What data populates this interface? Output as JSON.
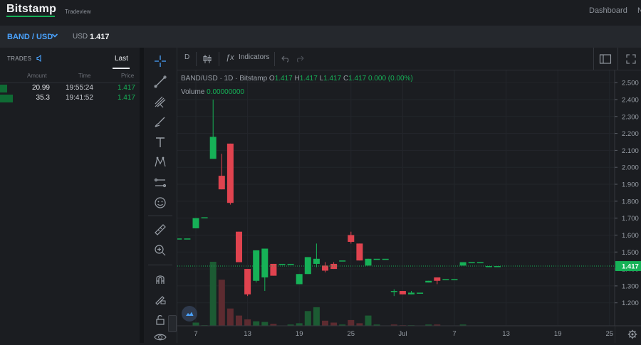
{
  "header": {
    "logo": "Bitstamp",
    "logo_sub": "Tradeview",
    "nav": [
      "Dashboard",
      "N"
    ]
  },
  "pair_bar": {
    "pair": "BAND / USD",
    "currency": "USD",
    "price": "1.417"
  },
  "trades": {
    "title": "TRADES",
    "tab": "Last",
    "columns": [
      "Amount",
      "Time",
      "Price"
    ],
    "rows": [
      {
        "amount": "20.99",
        "time": "19:55:24",
        "price": "1.417",
        "fill": 0.05
      },
      {
        "amount": "35.3",
        "time": "19:41:52",
        "price": "1.417",
        "fill": 0.09
      }
    ]
  },
  "chart_toolbar": {
    "interval": "D",
    "indicators": "Indicators"
  },
  "legend": {
    "symbol": "BAND/USD · 1D · Bitstamp",
    "o_label": "O",
    "o": "1.417",
    "h_label": "H",
    "h": "1.417",
    "l_label": "L",
    "l": "1.417",
    "c_label": "C",
    "c": "1.417",
    "change": "0.000 (0.00%)",
    "volume_label": "Volume",
    "volume": "0.00000000"
  },
  "colors": {
    "up": "#16b157",
    "down": "#e0434f",
    "up_volume": "#1c5b33",
    "down_volume": "#5d2b30",
    "accent": "#4aa3ff",
    "background": "#1b1d21"
  },
  "chart_data": {
    "type": "candlestick",
    "title": "",
    "ylim": [
      1.14,
      2.53
    ],
    "y_ticks": [
      "2.500",
      "2.400",
      "2.300",
      "2.200",
      "2.100",
      "2.000",
      "1.900",
      "1.800",
      "1.700",
      "1.600",
      "1.500",
      "1.400",
      "1.300",
      "1.200"
    ],
    "x_ticks": [
      {
        "label": "7",
        "day": 7
      },
      {
        "label": "13",
        "day": 13
      },
      {
        "label": "19",
        "day": 19
      },
      {
        "label": "25",
        "day": 25
      },
      {
        "label": "Jul",
        "day": 31
      },
      {
        "label": "7",
        "day": 37
      },
      {
        "label": "13",
        "day": 43
      },
      {
        "label": "19",
        "day": 49
      },
      {
        "label": "25",
        "day": 55
      }
    ],
    "last_price": "1.417",
    "last_value": 1.417,
    "candles": [
      {
        "day": 5,
        "o": 1.58,
        "h": 1.58,
        "l": 1.58,
        "c": 1.58
      },
      {
        "day": 6,
        "o": 1.58,
        "h": 1.58,
        "l": 1.58,
        "c": 1.58
      },
      {
        "day": 7,
        "o": 1.64,
        "h": 1.7,
        "l": 1.64,
        "c": 1.7
      },
      {
        "day": 8,
        "o": 1.705,
        "h": 1.705,
        "l": 1.705,
        "c": 1.705
      },
      {
        "day": 9,
        "o": 2.05,
        "h": 2.4,
        "l": 2.05,
        "c": 2.18
      },
      {
        "day": 10,
        "o": 1.95,
        "h": 2.08,
        "l": 1.87,
        "c": 1.87
      },
      {
        "day": 11,
        "o": 2.14,
        "h": 2.14,
        "l": 1.78,
        "c": 1.79
      },
      {
        "day": 12,
        "o": 1.62,
        "h": 1.62,
        "l": 1.44,
        "c": 1.44
      },
      {
        "day": 13,
        "o": 1.4,
        "h": 1.4,
        "l": 1.24,
        "c": 1.25
      },
      {
        "day": 14,
        "o": 1.33,
        "h": 1.51,
        "l": 1.32,
        "c": 1.51
      },
      {
        "day": 15,
        "o": 1.35,
        "h": 1.52,
        "l": 1.27,
        "c": 1.52
      },
      {
        "day": 16,
        "o": 1.43,
        "h": 1.43,
        "l": 1.36,
        "c": 1.36
      },
      {
        "day": 17,
        "o": 1.43,
        "h": 1.43,
        "l": 1.43,
        "c": 1.43
      },
      {
        "day": 18,
        "o": 1.43,
        "h": 1.43,
        "l": 1.43,
        "c": 1.43
      },
      {
        "day": 19,
        "o": 1.31,
        "h": 1.37,
        "l": 1.31,
        "c": 1.37
      },
      {
        "day": 20,
        "o": 1.37,
        "h": 1.47,
        "l": 1.37,
        "c": 1.47
      },
      {
        "day": 21,
        "o": 1.43,
        "h": 1.55,
        "l": 1.41,
        "c": 1.46
      },
      {
        "day": 22,
        "o": 1.42,
        "h": 1.44,
        "l": 1.38,
        "c": 1.39
      },
      {
        "day": 23,
        "o": 1.43,
        "h": 1.44,
        "l": 1.4,
        "c": 1.4
      },
      {
        "day": 24,
        "o": 1.45,
        "h": 1.45,
        "l": 1.45,
        "c": 1.45
      },
      {
        "day": 25,
        "o": 1.6,
        "h": 1.62,
        "l": 1.55,
        "c": 1.56
      },
      {
        "day": 26,
        "o": 1.55,
        "h": 1.55,
        "l": 1.45,
        "c": 1.45
      },
      {
        "day": 27,
        "o": 1.42,
        "h": 1.46,
        "l": 1.42,
        "c": 1.46
      },
      {
        "day": 28,
        "o": 1.46,
        "h": 1.46,
        "l": 1.46,
        "c": 1.46
      },
      {
        "day": 29,
        "o": 1.46,
        "h": 1.46,
        "l": 1.46,
        "c": 1.46
      },
      {
        "day": 30,
        "o": 1.27,
        "h": 1.28,
        "l": 1.24,
        "c": 1.27
      },
      {
        "day": 31,
        "o": 1.27,
        "h": 1.27,
        "l": 1.25,
        "c": 1.25
      },
      {
        "day": 32,
        "o": 1.25,
        "h": 1.27,
        "l": 1.25,
        "c": 1.26
      },
      {
        "day": 33,
        "o": 1.26,
        "h": 1.26,
        "l": 1.26,
        "c": 1.26
      },
      {
        "day": 34,
        "o": 1.32,
        "h": 1.33,
        "l": 1.32,
        "c": 1.33
      },
      {
        "day": 35,
        "o": 1.35,
        "h": 1.35,
        "l": 1.31,
        "c": 1.33
      },
      {
        "day": 36,
        "o": 1.34,
        "h": 1.34,
        "l": 1.34,
        "c": 1.34
      },
      {
        "day": 37,
        "o": 1.34,
        "h": 1.34,
        "l": 1.34,
        "c": 1.34
      },
      {
        "day": 38,
        "o": 1.42,
        "h": 1.44,
        "l": 1.42,
        "c": 1.44
      },
      {
        "day": 39,
        "o": 1.44,
        "h": 1.44,
        "l": 1.44,
        "c": 1.44
      },
      {
        "day": 40,
        "o": 1.44,
        "h": 1.44,
        "l": 1.44,
        "c": 1.44
      },
      {
        "day": 41,
        "o": 1.417,
        "h": 1.417,
        "l": 1.417,
        "c": 1.417
      },
      {
        "day": 42,
        "o": 1.417,
        "h": 1.417,
        "l": 1.417,
        "c": 1.417
      }
    ],
    "volume": [
      {
        "day": 5,
        "v": 0.0,
        "up": true
      },
      {
        "day": 6,
        "v": 0.0,
        "up": true
      },
      {
        "day": 7,
        "v": 0.05,
        "up": true
      },
      {
        "day": 8,
        "v": 0.01,
        "up": true
      },
      {
        "day": 9,
        "v": 1.0,
        "up": true
      },
      {
        "day": 10,
        "v": 0.72,
        "up": false
      },
      {
        "day": 11,
        "v": 0.27,
        "up": false
      },
      {
        "day": 12,
        "v": 0.16,
        "up": false
      },
      {
        "day": 13,
        "v": 0.1,
        "up": false
      },
      {
        "day": 14,
        "v": 0.07,
        "up": true
      },
      {
        "day": 15,
        "v": 0.06,
        "up": true
      },
      {
        "day": 16,
        "v": 0.03,
        "up": false
      },
      {
        "day": 17,
        "v": 0.0,
        "up": true
      },
      {
        "day": 18,
        "v": 0.02,
        "up": true
      },
      {
        "day": 19,
        "v": 0.04,
        "up": true
      },
      {
        "day": 20,
        "v": 0.23,
        "up": true
      },
      {
        "day": 21,
        "v": 0.29,
        "up": true
      },
      {
        "day": 22,
        "v": 0.08,
        "up": false
      },
      {
        "day": 23,
        "v": 0.05,
        "up": false
      },
      {
        "day": 24,
        "v": 0.02,
        "up": true
      },
      {
        "day": 25,
        "v": 0.09,
        "up": false
      },
      {
        "day": 26,
        "v": 0.04,
        "up": false
      },
      {
        "day": 27,
        "v": 0.16,
        "up": true
      },
      {
        "day": 28,
        "v": 0.02,
        "up": true
      },
      {
        "day": 29,
        "v": 0.0,
        "up": true
      },
      {
        "day": 30,
        "v": 0.02,
        "up": false
      },
      {
        "day": 31,
        "v": 0.01,
        "up": false
      },
      {
        "day": 32,
        "v": 0.01,
        "up": true
      },
      {
        "day": 33,
        "v": 0.0,
        "up": true
      },
      {
        "day": 34,
        "v": 0.02,
        "up": true
      },
      {
        "day": 35,
        "v": 0.02,
        "up": false
      },
      {
        "day": 36,
        "v": 0.0,
        "up": true
      },
      {
        "day": 37,
        "v": 0.0,
        "up": true
      },
      {
        "day": 38,
        "v": 0.02,
        "up": true
      },
      {
        "day": 39,
        "v": 0.0,
        "up": true
      },
      {
        "day": 40,
        "v": 0.0,
        "up": true
      },
      {
        "day": 41,
        "v": 0.0,
        "up": true
      },
      {
        "day": 42,
        "v": 0.0,
        "up": true
      }
    ]
  }
}
